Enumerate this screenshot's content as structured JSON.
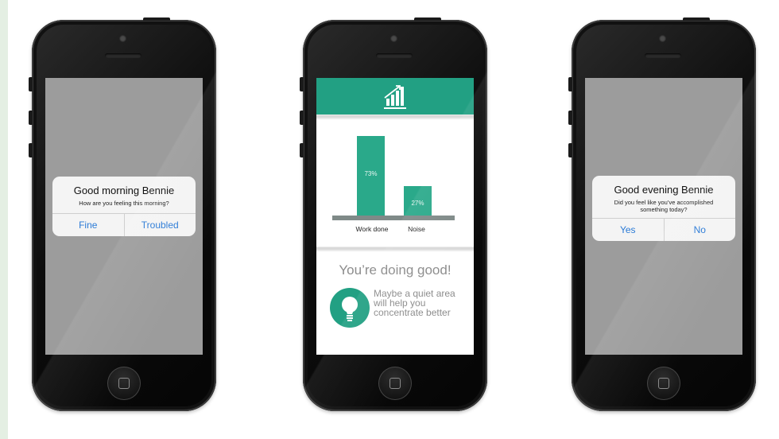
{
  "left_phone": {
    "alert": {
      "title": "Good morning Bennie",
      "message": "How are you feeling this morning?",
      "buttons": [
        "Fine",
        "Troubled"
      ]
    }
  },
  "middle_phone": {
    "header_icon": "bar-chart-growth-icon",
    "chart_data": {
      "type": "bar",
      "categories": [
        "Work done",
        "Noise"
      ],
      "values": [
        73,
        27
      ],
      "value_labels": [
        "73%",
        "27%"
      ],
      "ylim": [
        0,
        100
      ]
    },
    "status_title": "You’re doing good!",
    "tip": "Maybe a quiet area will help you concentrate better",
    "tip_icon": "lightbulb-icon",
    "accent_color": "#22a083"
  },
  "right_phone": {
    "alert": {
      "title": "Good evening Bennie",
      "message": "Did you feel like you’ve accomplished something today?",
      "buttons": [
        "Yes",
        "No"
      ]
    }
  }
}
